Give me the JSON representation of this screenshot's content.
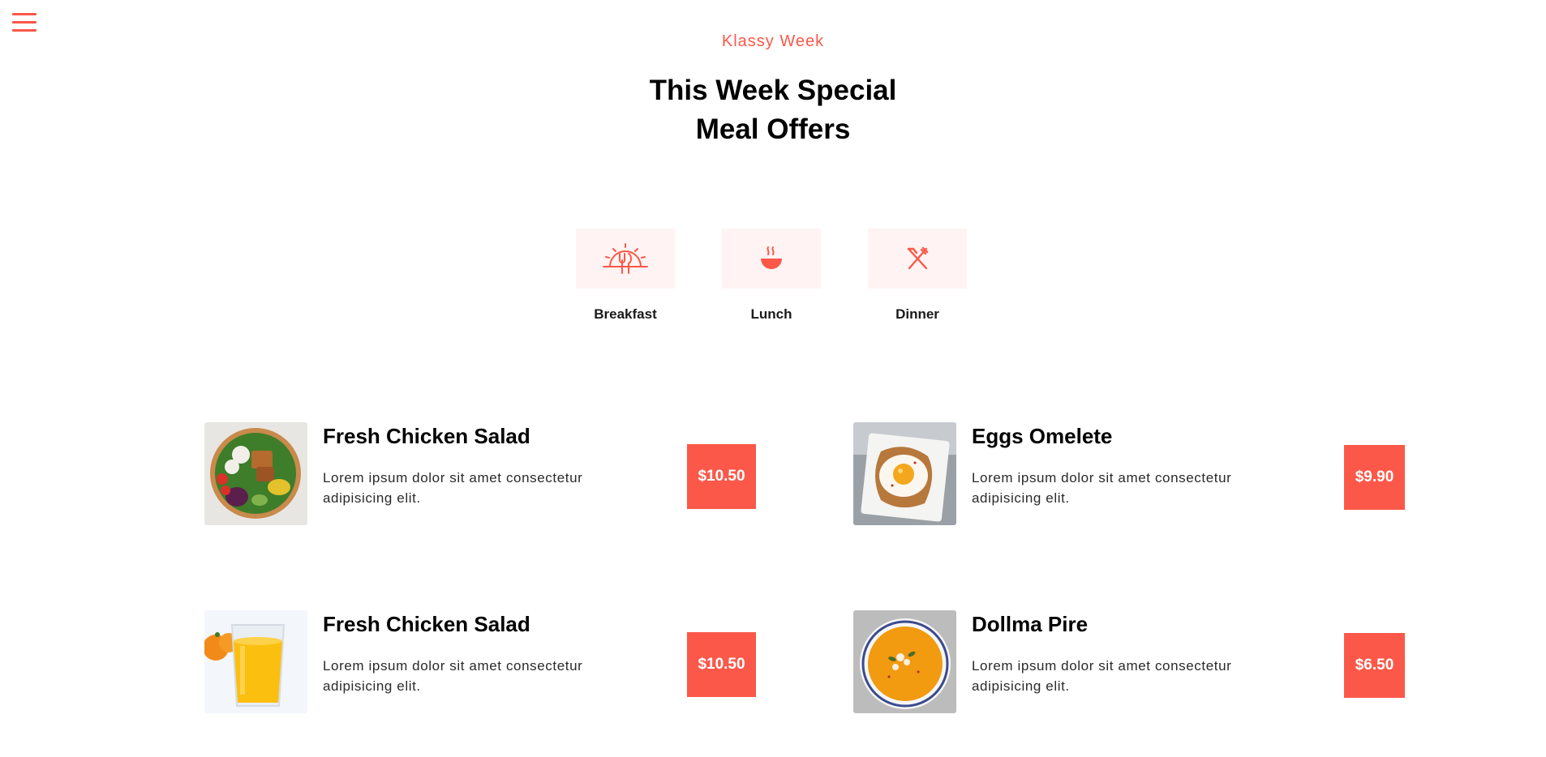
{
  "header": {
    "menu_icon": "hamburger-menu-icon",
    "eyebrow": "Klassy Week",
    "title_line1": "This Week Special",
    "title_line2": "Meal Offers"
  },
  "tabs": [
    {
      "label": "Breakfast",
      "icon": "sunrise-cutlery-icon"
    },
    {
      "label": "Lunch",
      "icon": "soup-bowl-icon"
    },
    {
      "label": "Dinner",
      "icon": "fork-knife-icon"
    }
  ],
  "items": [
    {
      "name": "Fresh Chicken Salad",
      "desc": "Lorem ipsum dolor sit amet consectetur adipisicing elit.",
      "price": "$10.50",
      "image": "salad-bowl"
    },
    {
      "name": "Eggs Omelete",
      "desc": "Lorem ipsum dolor sit amet consectetur adipisicing elit.",
      "price": "$9.90",
      "image": "egg-toast"
    },
    {
      "name": "Fresh Chicken Salad",
      "desc": "Lorem ipsum dolor sit amet consectetur adipisicing elit.",
      "price": "$10.50",
      "image": "orange-juice"
    },
    {
      "name": "Dollma Pire",
      "desc": "Lorem ipsum dolor sit amet consectetur adipisicing elit.",
      "price": "$6.50",
      "image": "pumpkin-soup"
    }
  ],
  "colors": {
    "accent": "#fb5849",
    "tab_bg": "#fff4f3"
  }
}
